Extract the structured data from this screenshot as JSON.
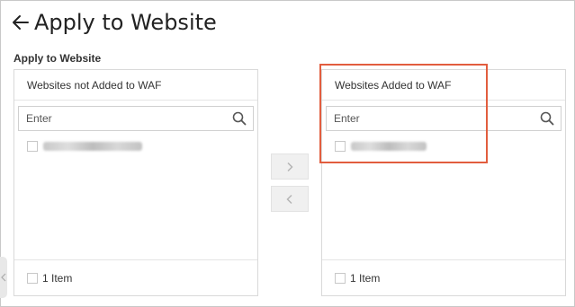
{
  "header": {
    "title": "Apply to Website",
    "back_icon": "arrow-left-icon"
  },
  "section": {
    "label": "Apply to Website"
  },
  "left_panel": {
    "title": "Websites not Added to WAF",
    "search_placeholder": "Enter",
    "items": [
      {
        "label": ""
      }
    ],
    "footer_count": "1 Item"
  },
  "right_panel": {
    "title": "Websites Added to WAF",
    "search_placeholder": "Enter",
    "items": [
      {
        "label": ""
      }
    ],
    "footer_count": "1 Item"
  },
  "transfer": {
    "to_right_icon": "chevron-right-icon",
    "to_left_icon": "chevron-left-icon"
  },
  "colors": {
    "highlight": "#e25d3e",
    "border": "#d9d9d9",
    "button_bg": "#f0f0f0"
  }
}
